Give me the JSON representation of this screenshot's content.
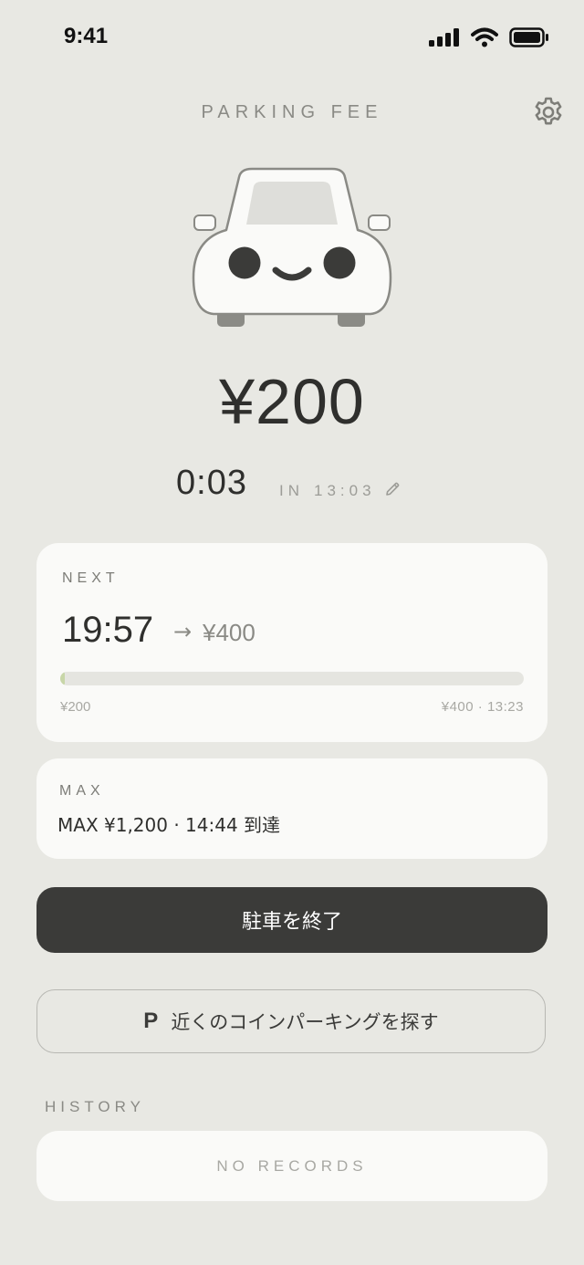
{
  "status_bar": {
    "time": "9:41"
  },
  "header": {
    "title": "PARKING FEE"
  },
  "fee": {
    "current": "¥200"
  },
  "session": {
    "elapsed": "0:03",
    "in_label": "IN",
    "in_time": "13:03"
  },
  "next": {
    "label": "NEXT",
    "time": "19:57",
    "arrow": "→",
    "fee": "¥400",
    "progress_fraction": 0.01,
    "range_start": "¥200",
    "range_end": "¥400 · 13:23"
  },
  "max": {
    "label": "MAX",
    "text": "MAX ¥1,200 · 14:44 到達"
  },
  "actions": {
    "end_label": "駐車を終了",
    "find_icon": "P",
    "find_label": "近くのコインパーキングを探す"
  },
  "history": {
    "label": "HISTORY",
    "empty_text": "NO RECORDS"
  },
  "colors": {
    "background": "#e8e8e3",
    "card": "#fafaf8",
    "primary_button": "#3b3b39",
    "progress_fill": "#c8d6a8"
  }
}
